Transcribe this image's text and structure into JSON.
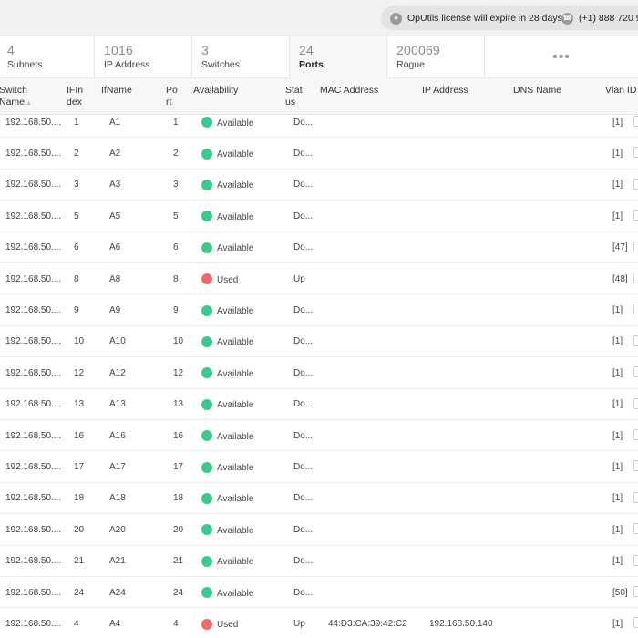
{
  "topbar": {
    "license_text": "OpUtils license will expire in 28 days",
    "license_icon": "license-icon",
    "phone_text": "(+1) 888 720 9",
    "phone_icon": "phone-icon"
  },
  "summary_tabs": [
    {
      "count": "4",
      "label": "Subnets",
      "active": false
    },
    {
      "count": "1016",
      "label": "IP Address",
      "active": false
    },
    {
      "count": "3",
      "label": "Switches",
      "active": false
    },
    {
      "count": "24",
      "label": "Ports",
      "active": true
    },
    {
      "count": "200069",
      "label": "Rogue",
      "active": false
    }
  ],
  "more_label": "•••",
  "columns": [
    {
      "line1": "Switch",
      "line2": "Name",
      "sortable": true
    },
    {
      "line1": "IFIn",
      "line2": "dex"
    },
    {
      "line1": "IfName",
      "line2": ""
    },
    {
      "line1": "Po",
      "line2": "rt"
    },
    {
      "line1": "Availability",
      "line2": ""
    },
    {
      "line1": "Stat",
      "line2": "us"
    },
    {
      "line1": "MAC Address",
      "line2": ""
    },
    {
      "line1": "IP Address",
      "line2": ""
    },
    {
      "line1": "DNS Name",
      "line2": ""
    },
    {
      "line1": "Vlan ID",
      "line2": ""
    }
  ],
  "colors": {
    "available": "#3cc98a",
    "used": "#f06a6a"
  },
  "rows": [
    {
      "switch": "192.168.50....",
      "ifindex": "1",
      "ifname": "A1",
      "port": "1",
      "availability": "Available",
      "status": "Do...",
      "mac": "",
      "ip": "",
      "dns": "",
      "vlan": "[1]"
    },
    {
      "switch": "192.168.50....",
      "ifindex": "2",
      "ifname": "A2",
      "port": "2",
      "availability": "Available",
      "status": "Do...",
      "mac": "",
      "ip": "",
      "dns": "",
      "vlan": "[1]"
    },
    {
      "switch": "192.168.50....",
      "ifindex": "3",
      "ifname": "A3",
      "port": "3",
      "availability": "Available",
      "status": "Do...",
      "mac": "",
      "ip": "",
      "dns": "",
      "vlan": "[1]"
    },
    {
      "switch": "192.168.50....",
      "ifindex": "5",
      "ifname": "A5",
      "port": "5",
      "availability": "Available",
      "status": "Do...",
      "mac": "",
      "ip": "",
      "dns": "",
      "vlan": "[1]"
    },
    {
      "switch": "192.168.50....",
      "ifindex": "6",
      "ifname": "A6",
      "port": "6",
      "availability": "Available",
      "status": "Do...",
      "mac": "",
      "ip": "",
      "dns": "",
      "vlan": "[47]"
    },
    {
      "switch": "192.168.50....",
      "ifindex": "8",
      "ifname": "A8",
      "port": "8",
      "availability": "Used",
      "status": "Up",
      "mac": "",
      "ip": "",
      "dns": "",
      "vlan": "[48]"
    },
    {
      "switch": "192.168.50....",
      "ifindex": "9",
      "ifname": "A9",
      "port": "9",
      "availability": "Available",
      "status": "Do...",
      "mac": "",
      "ip": "",
      "dns": "",
      "vlan": "[1]"
    },
    {
      "switch": "192.168.50....",
      "ifindex": "10",
      "ifname": "A10",
      "port": "10",
      "availability": "Available",
      "status": "Do...",
      "mac": "",
      "ip": "",
      "dns": "",
      "vlan": "[1]"
    },
    {
      "switch": "192.168.50....",
      "ifindex": "12",
      "ifname": "A12",
      "port": "12",
      "availability": "Available",
      "status": "Do...",
      "mac": "",
      "ip": "",
      "dns": "",
      "vlan": "[1]"
    },
    {
      "switch": "192.168.50....",
      "ifindex": "13",
      "ifname": "A13",
      "port": "13",
      "availability": "Available",
      "status": "Do...",
      "mac": "",
      "ip": "",
      "dns": "",
      "vlan": "[1]"
    },
    {
      "switch": "192.168.50....",
      "ifindex": "16",
      "ifname": "A16",
      "port": "16",
      "availability": "Available",
      "status": "Do...",
      "mac": "",
      "ip": "",
      "dns": "",
      "vlan": "[1]"
    },
    {
      "switch": "192.168.50....",
      "ifindex": "17",
      "ifname": "A17",
      "port": "17",
      "availability": "Available",
      "status": "Do...",
      "mac": "",
      "ip": "",
      "dns": "",
      "vlan": "[1]"
    },
    {
      "switch": "192.168.50....",
      "ifindex": "18",
      "ifname": "A18",
      "port": "18",
      "availability": "Available",
      "status": "Do...",
      "mac": "",
      "ip": "",
      "dns": "",
      "vlan": "[1]"
    },
    {
      "switch": "192.168.50....",
      "ifindex": "20",
      "ifname": "A20",
      "port": "20",
      "availability": "Available",
      "status": "Do...",
      "mac": "",
      "ip": "",
      "dns": "",
      "vlan": "[1]"
    },
    {
      "switch": "192.168.50....",
      "ifindex": "21",
      "ifname": "A21",
      "port": "21",
      "availability": "Available",
      "status": "Do...",
      "mac": "",
      "ip": "",
      "dns": "",
      "vlan": "[1]"
    },
    {
      "switch": "192.168.50....",
      "ifindex": "24",
      "ifname": "A24",
      "port": "24",
      "availability": "Available",
      "status": "Do...",
      "mac": "",
      "ip": "",
      "dns": "",
      "vlan": "[50]"
    },
    {
      "switch": "192.168.50....",
      "ifindex": "4",
      "ifname": "A4",
      "port": "4",
      "availability": "Used",
      "status": "Up",
      "mac": "44:D3:CA:39:42:C2",
      "ip": "192.168.50.140",
      "dns": "",
      "vlan": "[1]"
    }
  ]
}
